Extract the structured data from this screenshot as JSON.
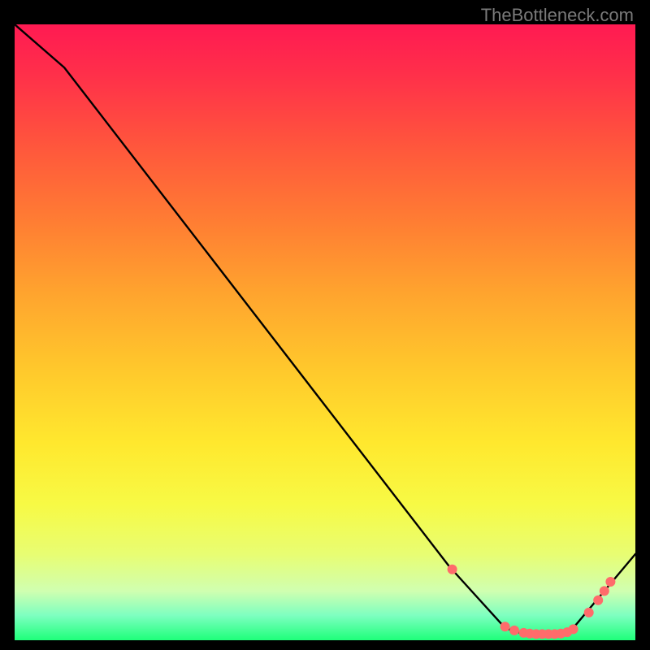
{
  "attribution": "TheBottleneck.com",
  "chart_data": {
    "type": "line",
    "title": "",
    "xlabel": "",
    "ylabel": "",
    "xlim": [
      0,
      100
    ],
    "ylim": [
      0,
      100
    ],
    "series": [
      {
        "name": "curve",
        "x": [
          0,
          8,
          70,
          79,
          82,
          84,
          86,
          88,
          90,
          100
        ],
        "values": [
          100,
          93,
          12,
          2,
          1,
          1,
          1,
          1,
          2,
          14
        ]
      }
    ],
    "markers": {
      "name": "highlight-dots",
      "color": "#ff6b6b",
      "x": [
        70.5,
        79,
        80.5,
        82,
        83,
        84,
        85,
        86,
        87,
        88,
        89,
        90,
        92.5,
        94,
        95,
        96
      ],
      "values": [
        11.5,
        2.2,
        1.6,
        1.2,
        1.1,
        1.0,
        1.0,
        1.0,
        1.0,
        1.1,
        1.3,
        1.8,
        4.5,
        6.5,
        8,
        9.5
      ]
    }
  },
  "colors": {
    "line": "#000000",
    "marker": "#ff6b6b",
    "bg_top": "#ff1a52",
    "bg_bottom": "#1eff7a"
  }
}
